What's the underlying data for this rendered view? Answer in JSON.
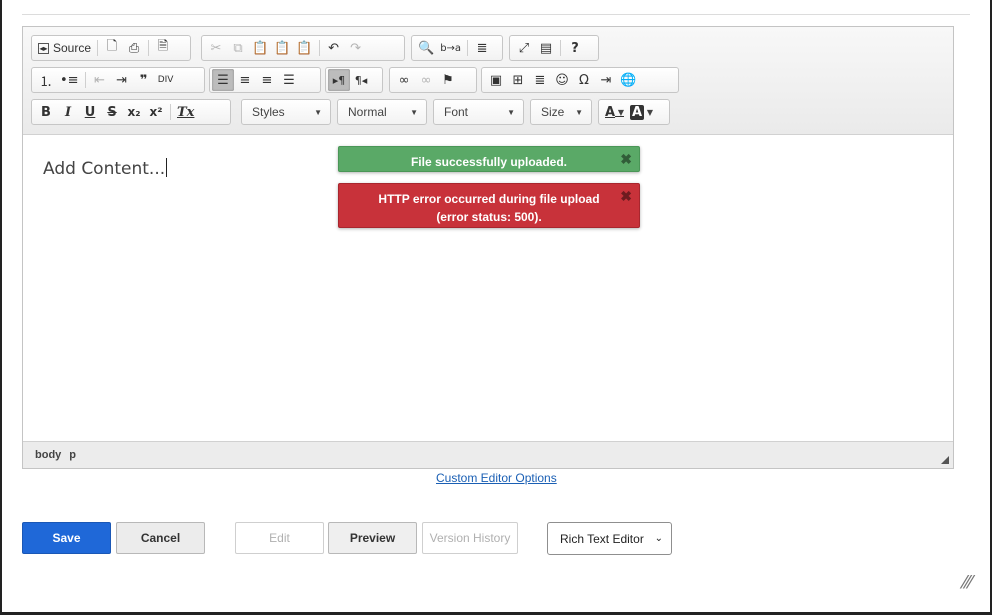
{
  "toolbar": {
    "row1": {
      "source_label": "Source",
      "find_replace_label": "b→a"
    },
    "row3": {
      "bold": "B",
      "italic": "I",
      "underline": "U",
      "strike": "S",
      "subscript": "x₂",
      "superscript": "x²",
      "remove_format": "Tx",
      "styles_label": "Styles",
      "format_label": "Normal",
      "font_label": "Font",
      "size_label": "Size",
      "text_color": "A",
      "bg_color": "A"
    }
  },
  "editor": {
    "placeholder": "Add Content...",
    "status_path": [
      "body",
      "p"
    ]
  },
  "notifications": {
    "success": "File successfully uploaded.",
    "error": "HTTP error occurred during file upload (error status: 500)."
  },
  "custom_editor_link": "Custom Editor Options",
  "actions": {
    "save": "Save",
    "cancel": "Cancel",
    "edit": "Edit",
    "preview": "Preview",
    "version_history": "Version History",
    "editor_type": "Rich Text Editor"
  },
  "colors": {
    "save_button": "#1f68d8",
    "success": "#5aa967",
    "error": "#c8323a",
    "link": "#1a5fb4"
  }
}
